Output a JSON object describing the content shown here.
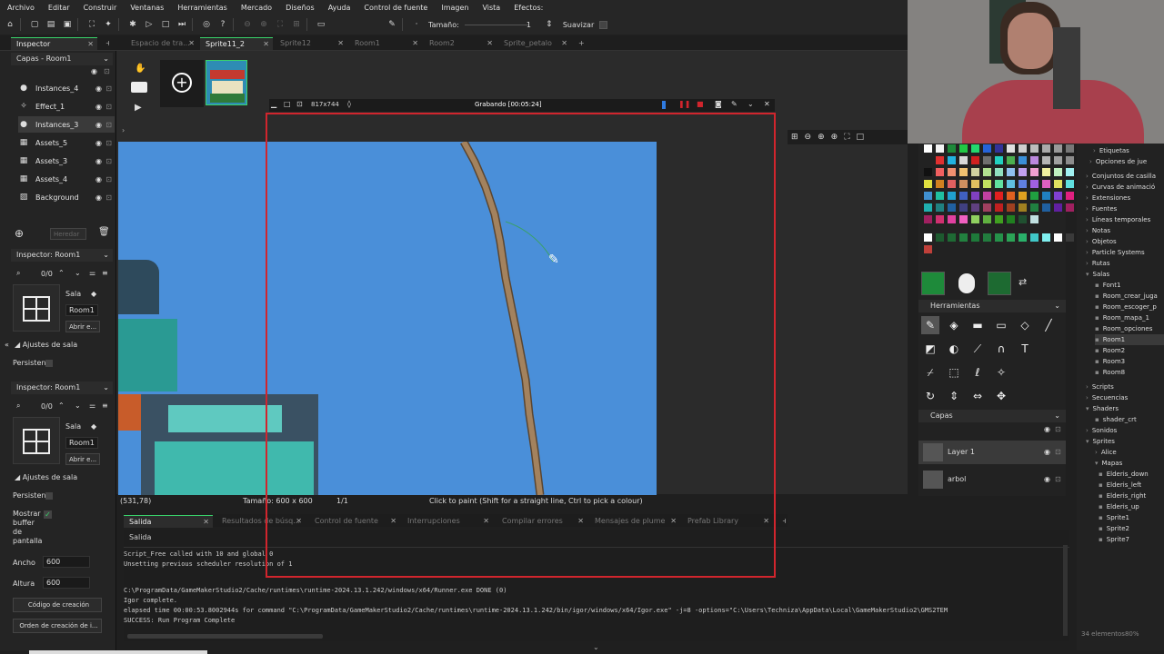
{
  "menu": [
    "Archivo",
    "Editar",
    "Construir",
    "Ventanas",
    "Herramientas",
    "Mercado",
    "Diseños",
    "Ayuda",
    "Control de fuente",
    "Imagen",
    "Vista",
    "Efectos:"
  ],
  "toolbar": {
    "size_label": "Tamaño:",
    "size_value": "1",
    "smooth_label": "Suavizar"
  },
  "tabs": [
    {
      "label": "Inspector",
      "active": true
    },
    {
      "label": "Espacio de tra...",
      "active": false
    },
    {
      "label": "Sprite11_2",
      "active": true
    },
    {
      "label": "Sprite12",
      "active": false
    },
    {
      "label": "Room1",
      "active": false
    },
    {
      "label": "Room2",
      "active": false
    },
    {
      "label": "Sprite_petalo",
      "active": false
    }
  ],
  "left": {
    "layers_header": "Capas - Room1",
    "layers": [
      "Instances_4",
      "Effect_1",
      "Instances_3",
      "Assets_5",
      "Assets_3",
      "Assets_4",
      "Background"
    ],
    "inherit": "Heredar",
    "inspector1": "Inspector: Room1",
    "count": "0/0",
    "room_word": "Sala",
    "room_name": "Room1",
    "open_btn": "Abrir e...",
    "room_settings": "Ajustes de sala",
    "persist": "Persistent",
    "inspector2": "Inspector: Room1",
    "count2": "0/0",
    "room_word2": "Sala",
    "room_name2": "Room1",
    "open_btn2": "Abrir e...",
    "room_settings2": "Ajustes de sala",
    "persist2": "Persistent",
    "show_buffer": [
      "Mostrar",
      "buffer",
      "de",
      "pantalla"
    ],
    "width_label": "Ancho",
    "width_val": "600",
    "height_label": "Altura",
    "height_val": "600",
    "creation_code": "Código de creación",
    "creation_order": "Orden de creación de i..."
  },
  "recorder": {
    "size": "817x744",
    "status": "Grabando [00:05:24]"
  },
  "status": {
    "coords": "(531,78)",
    "size": "Tamaño: 600 x 600",
    "frame": "1/1",
    "hint": "Click to paint (Shift for a straight line, Ctrl to pick a colour)"
  },
  "output_tabs": [
    "Salida",
    "Resultados de búsq...",
    "Control de fuente",
    "Interrupciones",
    "Compilar errores",
    "Mensajes de plume",
    "Prefab Library"
  ],
  "output": {
    "title": "Salida",
    "lines": [
      "Script_Free called with 10 and global 0",
      "Unsetting previous scheduler resolution of 1",
      "",
      "",
      "C:\\ProgramData/GameMakerStudio2/Cache/runtimes\\runtime-2024.13.1.242/windows/x64/Runner.exe DONE (0)",
      "Igor complete.",
      "elapsed time 00:00:53.8002944s for command \"C:\\ProgramData/GameMakerStudio2/Cache/runtimes\\runtime-2024.13.1.242/bin/igor/windows/x64/Igor.exe\" -j=8  -options=\"C:\\Users\\Techniza\\AppData\\Local\\GameMakerStudio2\\GMS2TEM",
      "SUCCESS: Run Program Complete"
    ]
  },
  "right": {
    "tools_header": "Herramientas",
    "layers_header": "Capas",
    "layers": [
      "Layer 1",
      "arbol"
    ]
  },
  "resources": {
    "items": [
      "Etiquetas",
      "Opciones de jue",
      "Conjuntos de casilla",
      "Curvas de animació",
      "Extensiones",
      "Fuentes",
      "Líneas temporales",
      "Notas",
      "Objetos",
      "Particle Systems",
      "Rutas",
      "Salas",
      "Font1",
      "Room_crear_juga",
      "Room_escoger_p",
      "Room_mapa_1",
      "Room_opciones",
      "Room1",
      "Room2",
      "Room3",
      "Room8",
      "Scripts",
      "Secuencias",
      "Shaders",
      "shader_crt",
      "Sonidos",
      "Sprites",
      "Alice",
      "Mapas",
      "Elderis_down",
      "Elderis_left",
      "Elderis_right",
      "Elderis_up",
      "Sprite1",
      "Sprite2",
      "Sprite7"
    ],
    "footer": "34 elementos"
  },
  "zoom": "80%",
  "colors": {
    "accent": "#39d46b",
    "record": "#d1252d",
    "canvas": "#4a8fd9",
    "trunk": "#9b7a5a"
  }
}
